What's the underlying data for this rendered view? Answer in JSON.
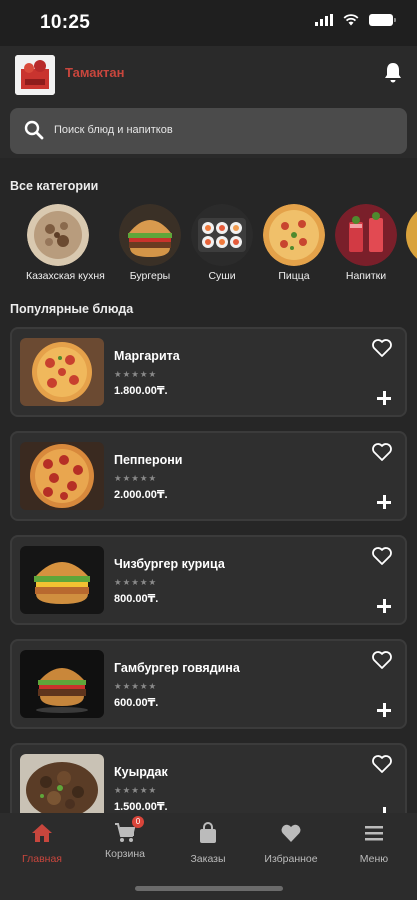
{
  "status": {
    "time": "10:25"
  },
  "header": {
    "title": "Тамактан"
  },
  "search": {
    "placeholder": "Поиск блюд и напитков"
  },
  "categories": {
    "title": "Все категории",
    "items": [
      {
        "label": "Казахская кухня",
        "icon": "kazakh-cuisine-image"
      },
      {
        "label": "Бургеры",
        "icon": "burger-image"
      },
      {
        "label": "Суши",
        "icon": "sushi-image"
      },
      {
        "label": "Пицца",
        "icon": "pizza-image"
      },
      {
        "label": "Напитки",
        "icon": "drinks-image"
      }
    ]
  },
  "popular": {
    "title": "Популярные блюда",
    "items": [
      {
        "name": "Маргарита",
        "price": "1.800.00₸.",
        "stars": "★★★★★"
      },
      {
        "name": "Пепперони",
        "price": "2.000.00₸.",
        "stars": "★★★★★"
      },
      {
        "name": "Чизбургер курица",
        "price": "800.00₸.",
        "stars": "★★★★★"
      },
      {
        "name": "Гамбургер говядина",
        "price": "600.00₸.",
        "stars": "★★★★★"
      },
      {
        "name": "Куырдак",
        "price": "1.500.00₸.",
        "stars": "★★★★★"
      }
    ]
  },
  "tabbar": {
    "items": [
      {
        "label": "Главная",
        "icon": "home-icon",
        "active": true
      },
      {
        "label": "Корзина",
        "icon": "cart-icon",
        "badge": "0"
      },
      {
        "label": "Заказы",
        "icon": "orders-bag-icon"
      },
      {
        "label": "Избранное",
        "icon": "heart-icon"
      },
      {
        "label": "Меню",
        "icon": "menu-icon"
      }
    ]
  },
  "colors": {
    "accent": "#c8463d",
    "background": "#262626",
    "card": "#2f2f2f"
  }
}
